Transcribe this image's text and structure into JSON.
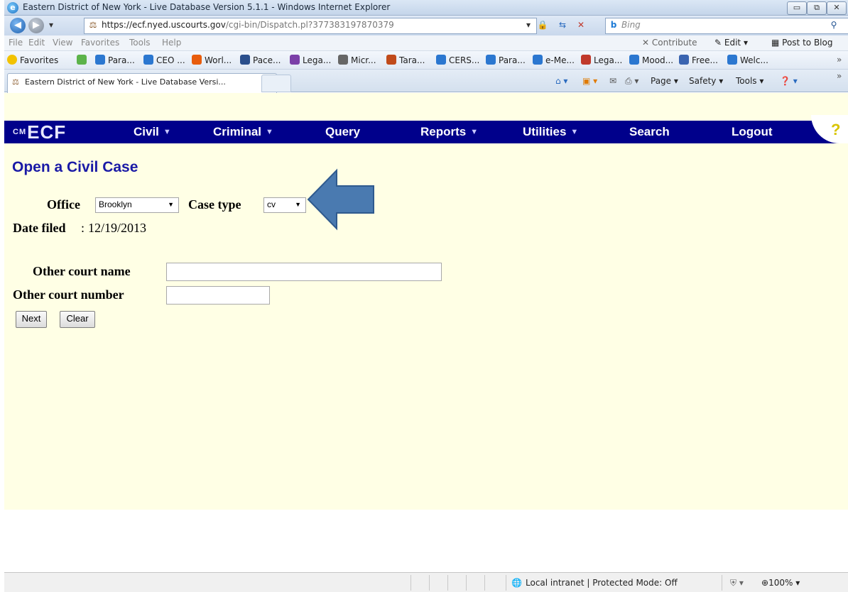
{
  "window": {
    "title": "Eastern District of New York - Live Database Version 5.1.1 - Windows Internet Explorer",
    "min_glyph": "▭",
    "max_glyph": "⧉",
    "close_glyph": "✕"
  },
  "address_bar": {
    "url_host": "https://ecf.nyed.uscourts.gov",
    "url_path": "/cgi-bin/Dispatch.pl?377383197870379",
    "search_placeholder": "Bing"
  },
  "menu": {
    "items": [
      "File",
      "Edit",
      "View",
      "Favorites",
      "Tools",
      "Help"
    ],
    "contribute": "Contribute",
    "edit": "Edit",
    "post_to_blog": "Post to Blog"
  },
  "favorites": {
    "label": "Favorites",
    "items": [
      "Para...",
      "CEO ...",
      "Worl...",
      "Pace...",
      "Lega...",
      "Micr...",
      "Tara...",
      "CERS...",
      "Para...",
      "e-Me...",
      "Lega...",
      "Mood...",
      "Free...",
      "Welc..."
    ]
  },
  "tabs": {
    "active_title": "Eastern District of New York - Live Database Versi...",
    "page": "Page",
    "safety": "Safety",
    "tools": "Tools"
  },
  "ecf_nav": {
    "logo": "ECF",
    "items": [
      "Civil",
      "Criminal",
      "Query",
      "Reports",
      "Utilities",
      "Search",
      "Logout"
    ],
    "help": "?"
  },
  "form": {
    "title": "Open a Civil Case",
    "office_label": "Office",
    "office_value": "Brooklyn",
    "case_type_label": "Case type",
    "case_type_value": "cv",
    "date_filed_label": "Date filed",
    "date_filed_value": "12/19/2013",
    "other_court_name_label": "Other court name",
    "other_court_name_value": "",
    "other_court_number_label": "Other court number",
    "other_court_number_value": "",
    "next_label": "Next",
    "clear_label": "Clear"
  },
  "status_bar": {
    "zone": "Local intranet | Protected Mode: Off",
    "zoom": "100%"
  },
  "colors": {
    "nav_background": "#00008b",
    "page_background": "#ffffe5",
    "title_color": "#1a1aa6",
    "arrow_fill": "#4a7ab0"
  }
}
